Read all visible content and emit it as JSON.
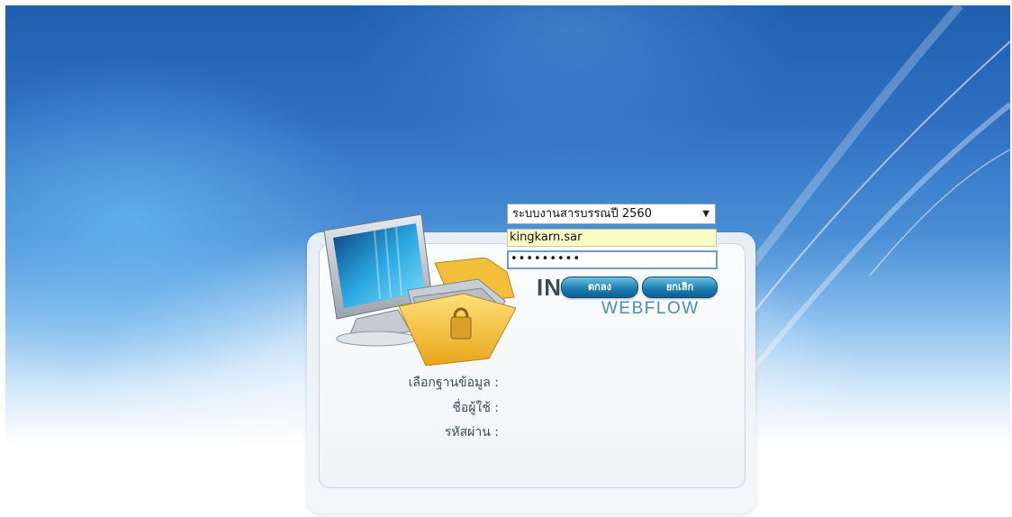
{
  "form": {
    "database_label": "เลือกฐานข้อมูล :",
    "username_label": "ชื่อผู้ใช้ :",
    "password_label": "รหัสผ่าน :",
    "database_selected": "ระบบงานสารบรรณปี 2560",
    "username_value": "kingkarn.sar",
    "password_mask": "•••••••••",
    "ok_label": "ตกลง",
    "cancel_label": "ยกเลิก"
  },
  "brand": {
    "name": "INI",
    "product": "WEBFLOW"
  },
  "icons": {
    "monitor": "computer-monitor-icon",
    "folder": "locked-folder-icon",
    "dropdown": "chevron-down-icon"
  },
  "colors": {
    "background_top": "#1f5fae",
    "username_fill": "#fbfbc6",
    "button": "#1f7fb3"
  }
}
